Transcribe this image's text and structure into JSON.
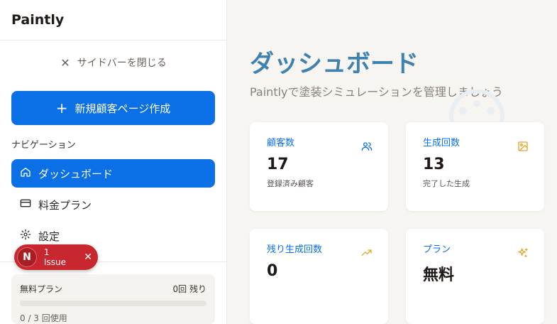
{
  "app": {
    "name": "Paintly"
  },
  "sidebar": {
    "close_label": "サイドバーを閉じる",
    "new_customer_button": "新規顧客ページ作成",
    "nav_title": "ナビゲーション",
    "items": [
      {
        "label": "ダッシュボード",
        "icon": "home-icon",
        "active": true
      },
      {
        "label": "料金プラン",
        "icon": "credit-card-icon",
        "active": false
      },
      {
        "label": "設定",
        "icon": "gear-icon",
        "active": false
      }
    ],
    "plan": {
      "name": "無料プラン",
      "remaining": "0回 残り",
      "usage": "0 / 3 回使用",
      "used": 0,
      "limit": 3
    }
  },
  "issue_badge": {
    "avatar_letter": "N",
    "label": "1 Issue"
  },
  "main": {
    "title": "ダッシュボード",
    "subtitle": "Paintlyで塗装シミュレーションを管理しましょう",
    "cards": [
      {
        "label": "顧客数",
        "value": "17",
        "caption": "登録済み顧客",
        "icon": "users-icon"
      },
      {
        "label": "生成回数",
        "value": "13",
        "caption": "完了した生成",
        "icon": "image-icon"
      },
      {
        "label": "残り生成回数",
        "value": "0",
        "caption": "",
        "icon": "trending-up-icon"
      },
      {
        "label": "プラン",
        "value": "無料",
        "caption": "",
        "icon": "sparkles-icon"
      }
    ]
  },
  "colors": {
    "accent": "#0b6fe6",
    "title": "#3f82b0",
    "badge": "#c9272f",
    "orange": "#e8a22a"
  }
}
